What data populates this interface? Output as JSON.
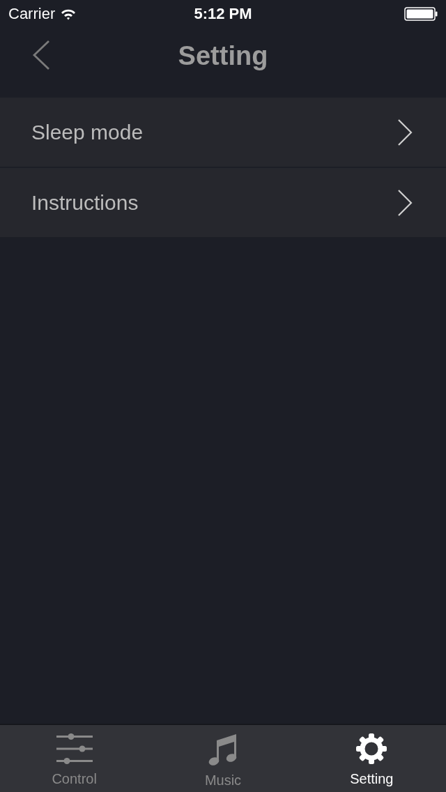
{
  "status_bar": {
    "carrier": "Carrier",
    "time": "5:12 PM"
  },
  "nav_bar": {
    "title": "Setting"
  },
  "menu_items": [
    {
      "label": "Sleep mode"
    },
    {
      "label": "Instructions"
    }
  ],
  "tab_bar": {
    "tabs": [
      {
        "label": "Control",
        "kind": "sliders",
        "selected": false
      },
      {
        "label": "Music",
        "kind": "music",
        "selected": false
      },
      {
        "label": "Setting",
        "kind": "gear",
        "selected": true
      }
    ]
  }
}
